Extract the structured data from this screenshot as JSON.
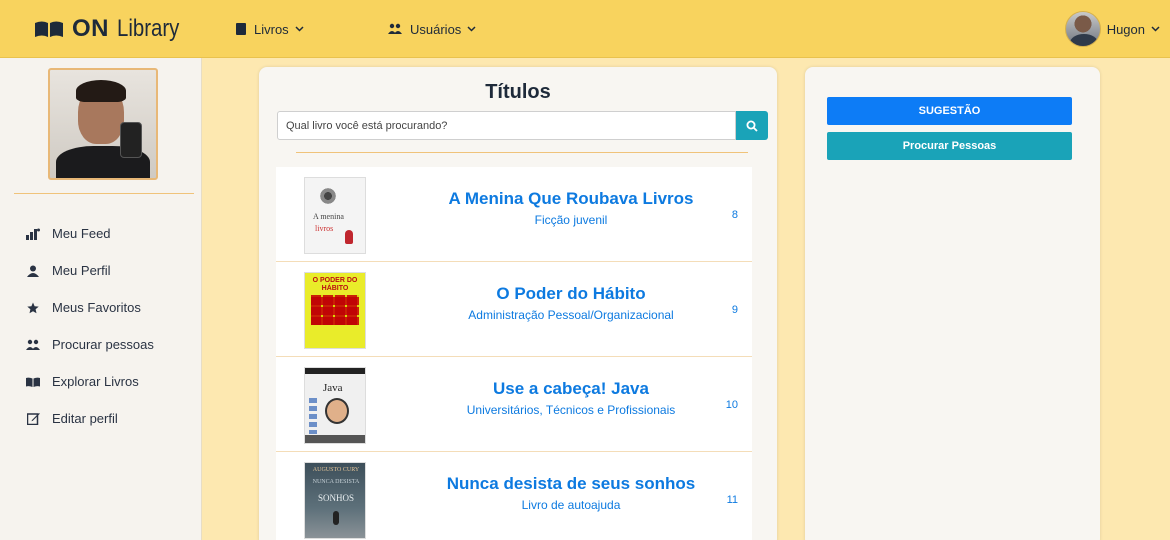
{
  "brand": {
    "bold": "ON",
    "text": "Library"
  },
  "navbar": {
    "menu_livros": "Livros",
    "menu_usuarios": "Usuários",
    "user_name": "Hugon"
  },
  "sidebar": {
    "items": [
      {
        "label": "Meu Feed",
        "icon": "feed-icon"
      },
      {
        "label": "Meu Perfil",
        "icon": "user-icon"
      },
      {
        "label": "Meus Favoritos",
        "icon": "star-icon"
      },
      {
        "label": "Procurar pessoas",
        "icon": "users-icon"
      },
      {
        "label": "Explorar Livros",
        "icon": "book-open-icon"
      },
      {
        "label": "Editar perfil",
        "icon": "edit-icon"
      }
    ]
  },
  "main": {
    "title": "Títulos",
    "search": {
      "placeholder": "Qual livro você está procurando?",
      "value": ""
    },
    "books": [
      {
        "title": "A Menina Que Roubava Livros",
        "genre": "Ficção juvenil",
        "number": "8",
        "cover": {
          "line1": "A menina",
          "line2": "livros"
        }
      },
      {
        "title": "O Poder do Hábito",
        "genre": "Administração Pessoal/Organizacional",
        "number": "9",
        "cover": {
          "line1": "O PODER DO HÁBITO"
        }
      },
      {
        "title": "Use a cabeça! Java",
        "genre": "Universitários, Técnicos e Profissionais",
        "number": "10",
        "cover": {
          "line1": "Java"
        }
      },
      {
        "title": "Nunca desista de seus sonhos",
        "genre": "Livro de autoajuda",
        "number": "11",
        "cover": {
          "line1": "AUGUSTO CURY",
          "line2": "NUNCA DESISTA",
          "line3": "SONHOS"
        }
      }
    ]
  },
  "right": {
    "sugestao_label": "SUGESTÃO",
    "procurar_label": "Procurar Pessoas"
  },
  "colors": {
    "navbar": "#f8d35e",
    "page_bg": "#fde8b0",
    "link_blue": "#0d7ae0",
    "button_blue": "#0d7cf6",
    "button_teal": "#1aa3b8"
  }
}
